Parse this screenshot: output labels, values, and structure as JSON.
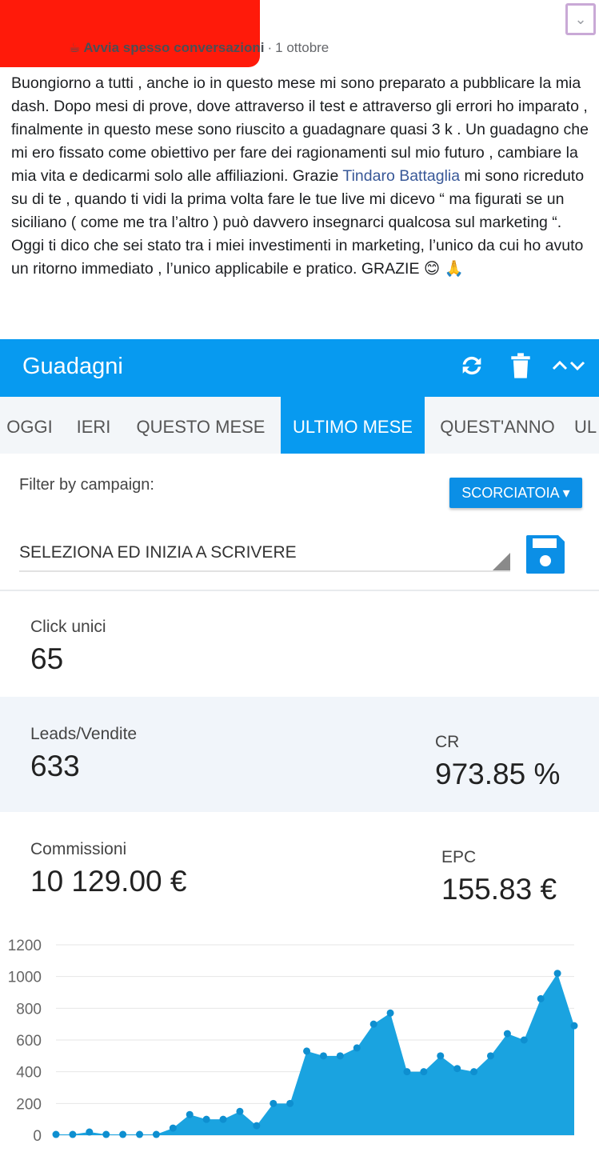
{
  "post": {
    "group_name": "Avvia spesso conversazioni",
    "separator": "·",
    "date": "1 ottobre",
    "text_before": "Buongiorno a tutti , anche io in questo mese mi sono preparato a pubblicare la mia dash. Dopo mesi di prove, dove attraverso il test e attraverso gli errori ho imparato , finalmente in questo mese sono riuscito a guadagnare quasi 3 k . Un guadagno che mi ero fissato come obiettivo per fare dei ragionamenti sul mio futuro , cambiare la mia vita e dedicarmi solo alle affiliazioni. Grazie ",
    "mention": "Tindaro Battaglia",
    "text_after": " mi sono ricreduto su di te , quando ti vidi la prima volta fare le tue live mi dicevo “ ma figurati se un siciliano ( come me tra l’altro ) può davvero insegnarci qualcosa sul marketing “. Oggi ti dico che sei stato tra i miei investimenti in marketing, l’unico da cui ho avuto un ritorno immediato , l’unico applicabile e pratico. GRAZIE ",
    "emoji": "😊 🙏"
  },
  "icons": {
    "menu": "chevron-down-icon",
    "group": "coffee-cup-icon",
    "refresh": "refresh-icon",
    "trash": "trash-icon",
    "collapse": "chevron-up-down-icon",
    "save": "floppy-disk-icon"
  },
  "app": {
    "title": "Guadagni",
    "tabs": [
      {
        "label": "OGGI"
      },
      {
        "label": "IERI"
      },
      {
        "label": "QUESTO MESE"
      },
      {
        "label": "ULTIMO MESE",
        "active": true
      },
      {
        "label": "QUEST'ANNO"
      },
      {
        "label": "UL"
      }
    ],
    "filter_label": "Filter by campaign:",
    "shortcut_button": "SCORCIATOIA ▾",
    "campaign_value": "SELEZIONA ED INIZIA A SCRIVERE",
    "stats": {
      "clicks_label": "Click unici",
      "clicks_value": "65",
      "leads_label": "Leads/Vendite",
      "leads_value": "633",
      "cr_label": "CR",
      "cr_value": "973.85 %",
      "commissions_label": "Commissioni",
      "commissions_value": "10 129.00 €",
      "epc_label": "EPC",
      "epc_value": "155.83 €"
    }
  },
  "colors": {
    "accent": "#079af0",
    "shaded_row": "#f1f5fa",
    "mention": "#385898",
    "chart_fill": "#1aa3e0",
    "chart_point": "#0e8fd0"
  },
  "chart_data": {
    "type": "area",
    "title": "",
    "xlabel": "",
    "ylabel": "",
    "ylim": [
      0,
      1200
    ],
    "yticks": [
      0,
      200,
      400,
      600,
      800,
      1000,
      1200
    ],
    "grid": true,
    "x": [
      1,
      2,
      3,
      4,
      5,
      6,
      7,
      8,
      9,
      10,
      11,
      12,
      13,
      14,
      15,
      16,
      17,
      18,
      19,
      20,
      21,
      22,
      23,
      24,
      25,
      26,
      27,
      28,
      29,
      30,
      31
    ],
    "series": [
      {
        "values": [
          5,
          5,
          20,
          5,
          5,
          5,
          5,
          45,
          130,
          100,
          100,
          150,
          60,
          200,
          200,
          530,
          500,
          500,
          550,
          700,
          770,
          400,
          400,
          500,
          420,
          400,
          500,
          640,
          600,
          860,
          1020,
          690
        ]
      }
    ]
  }
}
